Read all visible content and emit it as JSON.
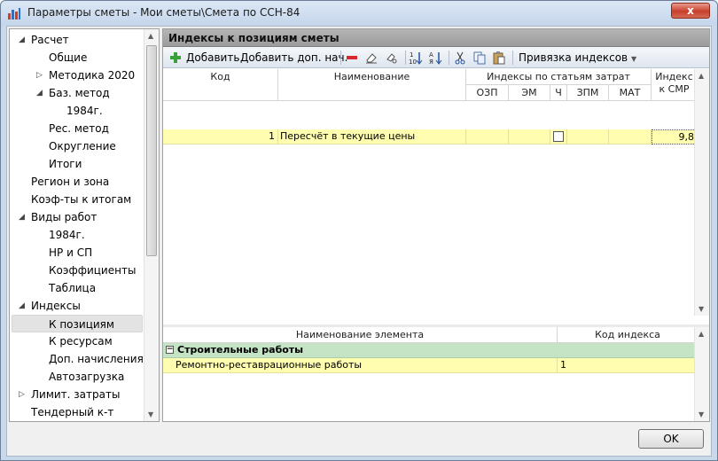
{
  "window": {
    "title": "Параметры сметы - Мои сметы\\Смета по ССН-84",
    "close_label": "x"
  },
  "tree": {
    "items": [
      {
        "label": "Расчет",
        "level": 0,
        "expanded": true
      },
      {
        "label": "Общие",
        "level": 1
      },
      {
        "label": "Методика 2020",
        "level": 1,
        "collapsed": true
      },
      {
        "label": "Баз. метод",
        "level": 1,
        "expanded": true
      },
      {
        "label": "1984г.",
        "level": 2
      },
      {
        "label": "Рес. метод",
        "level": 1
      },
      {
        "label": "Округление",
        "level": 1
      },
      {
        "label": "Итоги",
        "level": 1
      },
      {
        "label": "Регион и зона",
        "level": 0
      },
      {
        "label": "Коэф-ты к итогам",
        "level": 0
      },
      {
        "label": "Виды работ",
        "level": 0,
        "expanded": true
      },
      {
        "label": "1984г.",
        "level": 1
      },
      {
        "label": "НР и СП",
        "level": 1
      },
      {
        "label": "Коэффициенты",
        "level": 1
      },
      {
        "label": "Таблица",
        "level": 1
      },
      {
        "label": "Индексы",
        "level": 0,
        "expanded": true
      },
      {
        "label": "К позициям",
        "level": 1,
        "selected": true
      },
      {
        "label": "К ресурсам",
        "level": 1
      },
      {
        "label": "Доп. начисления",
        "level": 1
      },
      {
        "label": "Автозагрузка",
        "level": 1
      },
      {
        "label": "Лимит. затраты",
        "level": 0,
        "collapsed": true
      },
      {
        "label": "Тендерный к-т",
        "level": 0
      }
    ]
  },
  "panel": {
    "title": "Индексы к позициям сметы"
  },
  "toolbar": {
    "add_label": "Добавить",
    "add_extra_label": "Добавить доп. нач.",
    "binding_label": "Привязка индексов"
  },
  "grid1": {
    "headers": {
      "code": "Код",
      "name": "Наименование",
      "by_cost_items": "Индексы по статьям затрат",
      "ozp": "ОЗП",
      "em": "ЭМ",
      "ch": "Ч",
      "zpm": "ЗПМ",
      "mat": "МАТ",
      "smr": "Индекс к СМР"
    },
    "rows": [
      {
        "code": "1",
        "name": "Пересчёт в текущие цены",
        "ozp": "",
        "em": "",
        "zpm": "",
        "mat": "",
        "smr": "9,8"
      }
    ]
  },
  "grid2": {
    "headers": {
      "element_name": "Наименование элемента",
      "index_code": "Код индекса"
    },
    "group": {
      "label": "Строительные работы",
      "toggle": "−"
    },
    "rows": [
      {
        "name": "Ремонтно-реставрационные работы",
        "code": "1"
      }
    ]
  },
  "footer": {
    "ok_label": "OK"
  },
  "colors": {
    "selected_row": "#fffeb0",
    "group_row": "#c5e3c5",
    "panel_title": "#a8a8a8",
    "close_button": "#c7402b"
  }
}
